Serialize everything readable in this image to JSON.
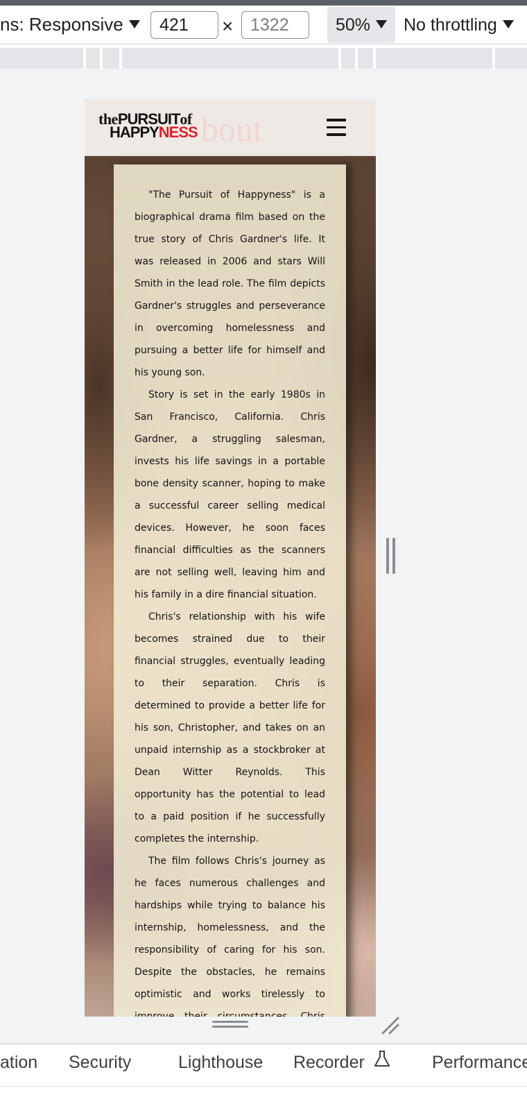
{
  "toolbar": {
    "dimensions_label": "ns: Responsive",
    "width_value": "421",
    "height_placeholder": "1322",
    "times_symbol": "×",
    "zoom_label": "50%",
    "throttle_label": "No throttling"
  },
  "site": {
    "logo_top_the": "the",
    "logo_top_pursuit": "PURSUIT",
    "logo_top_of": "of",
    "logo_bottom_happy": "HAPPY",
    "logo_bottom_ness": "NESS",
    "ghost_title": "bout",
    "paragraphs": [
      "\"The Pursuit of Happyness\" is a biographical drama film based on the true story of Chris Gardner's life. It was released in 2006 and stars Will Smith in the lead role. The film depicts Gardner's struggles and perseverance in overcoming homelessness and pursuing a better life for himself and his young son.",
      "Story is set in the early 1980s in San Francisco, California. Chris Gardner, a struggling salesman, invests his life savings in a portable bone density scanner, hoping to make a successful career selling medical devices. However, he soon faces financial difficulties as the scanners are not selling well, leaving him and his family in a dire financial situation.",
      "Chris's relationship with his wife becomes strained due to their financial struggles, eventually leading to their separation. Chris is determined to provide a better life for his son, Christopher, and takes on an unpaid internship as a stockbroker at Dean Witter Reynolds. This opportunity has the potential to lead to a paid position if he successfully completes the internship.",
      "The film follows Chris's journey as he faces numerous challenges and hardships while trying to balance his internship, homelessness, and the responsibility of caring for his son. Despite the obstacles, he remains optimistic and works tirelessly to improve their circumstances. Chris and"
    ]
  },
  "tabs": {
    "items": [
      "ation",
      "Security",
      "Lighthouse",
      "Recorder",
      "Performance"
    ]
  },
  "icons": {
    "dropdown": "caret-down-icon",
    "menu": "hamburger-icon",
    "flask": "flask-icon",
    "resize": "resize-handle-icon"
  },
  "colors": {
    "brand_red": "#d8232a",
    "devtools_bg": "#f1f3f4",
    "card_bg": "#f2ecd4"
  }
}
